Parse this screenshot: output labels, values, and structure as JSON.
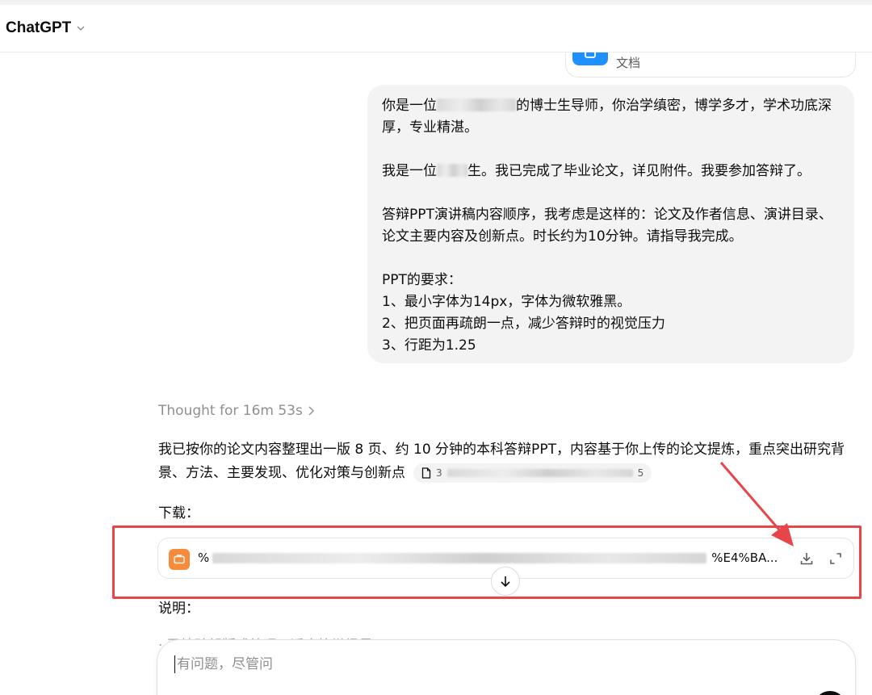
{
  "header": {
    "title": "ChatGPT"
  },
  "attached_file": {
    "type_label": "文档"
  },
  "user_message": {
    "paragraphs": [
      "你是一位",
      "的博士生导师，你治学缜密，博学多才，学术功底深厚，专业精湛。",
      "我是一位",
      "生。我已完成了毕业论文，详见附件。我要参加答辩了。",
      "答辩PPT演讲稿内容顺序，我考虑是这样的：论文及作者信息、演讲目录、论文主要内容及创新点。时长约为10分钟。请指导我完成。",
      "PPT的要求：",
      "1、最小字体为14px，字体为微软雅黑。",
      "2、把页面再疏朗一点，减少答辩时的视觉压力",
      "3、行距为1.25"
    ]
  },
  "assistant": {
    "thought_label": "Thought for 16m 53s",
    "reply_text": "我已按你的论文内容整理出一版 8 页、约 10 分钟的本科答辩PPT，内容基于你上传的论文提炼，重点突出研究背景、方法、主要发现、优化对策与创新点",
    "citation_prefix": "3",
    "citation_suffix": "5",
    "download_label": "下载：",
    "attachment": {
      "name_prefix": "%",
      "name_suffix": "%E4%BA..."
    },
    "explain_label": "说明：",
    "faded_line": "· 已按疏朗版式处理，适合答辩场景"
  },
  "composer": {
    "placeholder": "有问题，尽管问"
  },
  "icons": {
    "model_switcher": "chevron-down-icon",
    "file": "document-icon",
    "citation": "file-icon",
    "attachment": "slides-icon",
    "download": "download-icon",
    "expand": "expand-icon",
    "scroll": "arrow-down-icon",
    "send": "send-icon"
  },
  "colors": {
    "annotation_red": "#e8454a",
    "doc_blue": "#1e90ff",
    "slides_orange": "#f68b3b",
    "bubble_gray": "#f3f3f3"
  }
}
